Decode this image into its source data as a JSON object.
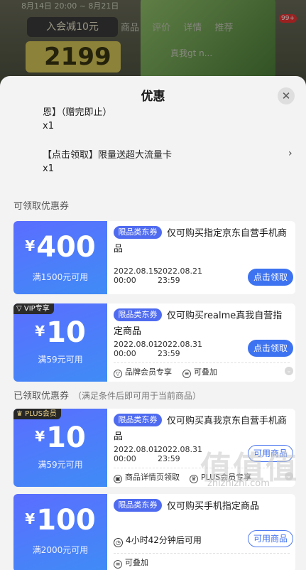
{
  "background": {
    "dates": "8月14日 20:00 ~ 8月21日",
    "member_tag": "入会减10元",
    "tabs": "商品 评价 详情 推荐",
    "price": "2199",
    "search_hint": "真我gt n...",
    "message_badge": "99+"
  },
  "sheet": {
    "title": "优惠",
    "close_icon": "close-icon"
  },
  "gifts": [
    {
      "name": "恩】（赠完即止）",
      "qty": "x1"
    },
    {
      "name": "【点击领取】限量送超大流量卡",
      "qty": "x1"
    }
  ],
  "sections": {
    "available": "可领取优惠券",
    "received": "已领取优惠券",
    "received_note": "（满足条件后即可用于当前商品）"
  },
  "coupons": [
    {
      "amount": "400",
      "condition": "满1500元可用",
      "badge": "限品类东券",
      "description": "仅可购买指定京东自营手机商品",
      "start_date": "2022.08.15",
      "start_time": "00:00",
      "end_date": "2022.08.21",
      "end_time": "23:59",
      "button": "点击领取"
    },
    {
      "corner": "VIP专享",
      "amount": "10",
      "condition": "满59元可用",
      "badge": "限品类东券",
      "description": "仅可购买realme真我自营指定商品",
      "start_date": "2022.08.01",
      "start_time": "00:00",
      "end_date": "2022.08.31",
      "end_time": "23:59",
      "button": "点击领取",
      "features": [
        "品牌会员专享",
        "可叠加"
      ]
    },
    {
      "corner": "PLUS会员",
      "amount": "10",
      "condition": "满59元可用",
      "badge": "限品类东券",
      "description": "仅可购买真我京东自营手机商品",
      "start_date": "2022.08.01",
      "start_time": "00:00",
      "end_date": "2022.08.31",
      "end_time": "23:59",
      "button": "可用商品",
      "features": [
        "商品详情页领取",
        "PLUS会员专享"
      ]
    },
    {
      "amount": "100",
      "condition": "满2000元可用",
      "badge": "限品类东券",
      "description": "仅可购买手机指定商品",
      "countdown": "4小时42分钟后可用",
      "button": "可用商品",
      "features": [
        "可叠加"
      ]
    }
  ],
  "watermark": {
    "text": "值值值",
    "url": "zhizhizhi.com"
  },
  "colors": {
    "coupon_gradient_start": "#5b6dff",
    "coupon_gradient_end": "#3f8cf6",
    "button_blue": "#3d73f0"
  }
}
